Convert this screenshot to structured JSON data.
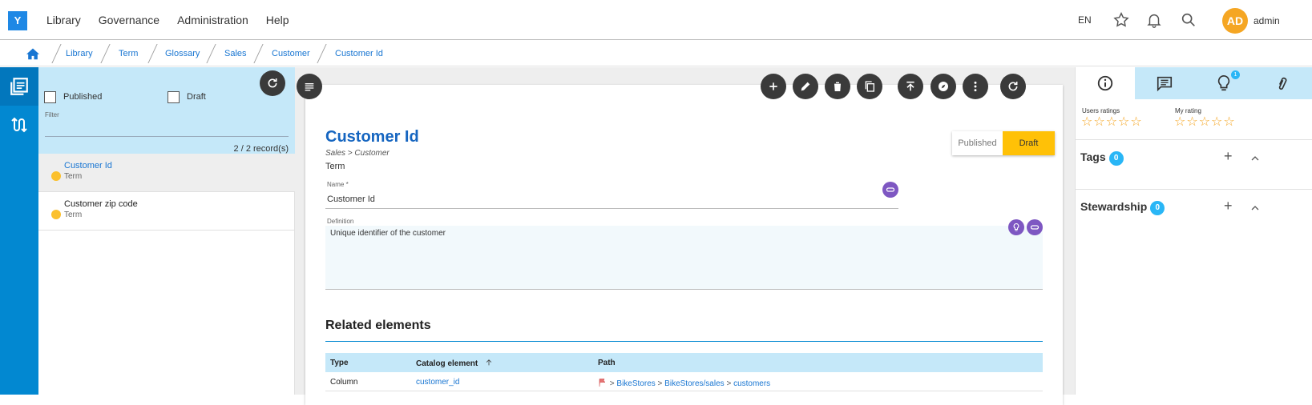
{
  "app": {
    "logo": "Y"
  },
  "menu": [
    "Library",
    "Governance",
    "Administration",
    "Help"
  ],
  "topbar": {
    "lang": "EN",
    "avatar_initials": "AD",
    "username": "admin"
  },
  "breadcrumb": [
    "Library",
    "Term",
    "Glossary",
    "Sales",
    "Customer",
    "Customer Id"
  ],
  "filter": {
    "published_label": "Published",
    "draft_label": "Draft",
    "filter_label": "Filter",
    "records": "2 / 2 record(s)"
  },
  "list": [
    {
      "name": "Customer Id",
      "type": "Term"
    },
    {
      "name": "Customer zip code",
      "type": "Term"
    }
  ],
  "detail": {
    "title": "Customer Id",
    "path": "Sales >  Customer",
    "type": "Term",
    "status_published": "Published",
    "status_draft": "Draft",
    "name_label": "Name *",
    "name_value": "Customer Id",
    "definition_label": "Definition",
    "definition_value": "Unique identifier of the customer",
    "related_title": "Related elements",
    "table": {
      "headers": [
        "Type",
        "Catalog element",
        "Path"
      ],
      "rows": [
        {
          "type": "Column",
          "element": "customer_id",
          "path": [
            "BikeStores",
            "BikeStores/sales",
            "customers"
          ]
        }
      ]
    }
  },
  "right": {
    "tab_badge": "1",
    "users_ratings_label": "Users ratings",
    "my_rating_label": "My rating",
    "stars": "☆☆☆☆☆",
    "tags_label": "Tags",
    "tags_count": "0",
    "stewardship_label": "Stewardship",
    "stewardship_count": "0"
  },
  "colors": {
    "accent": "#0288d1",
    "title": "#1565c0",
    "draft": "#ffc107",
    "badge": "#29b6f6"
  }
}
